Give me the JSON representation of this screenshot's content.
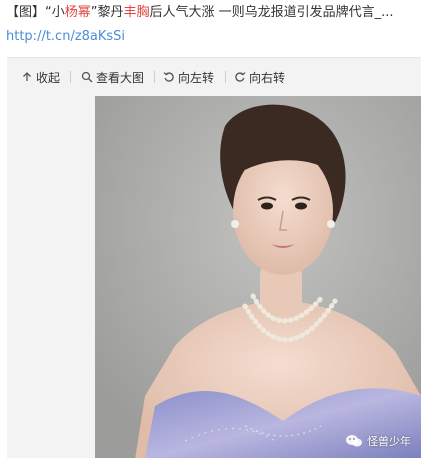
{
  "post": {
    "title_parts": [
      {
        "text": "【图】“小",
        "highlight": false
      },
      {
        "text": "杨幂",
        "highlight": true
      },
      {
        "text": "”黎丹",
        "highlight": false
      },
      {
        "text": "丰胸",
        "highlight": true
      },
      {
        "text": "后人气大涨 一则乌龙报道引发品牌代言_...",
        "highlight": false
      }
    ],
    "link": "http://t.cn/z8aKsSi"
  },
  "toolbar": {
    "collapse_label": "收起",
    "view_large_label": "查看大图",
    "rotate_left_label": "向左转",
    "rotate_right_label": "向右转"
  },
  "watermark": {
    "text": "怪兽少年"
  },
  "colors": {
    "highlight": "#e0463f",
    "link": "#4a8dd6",
    "panel_bg": "#f3f3f3"
  },
  "icons": [
    "collapse-arrow-icon",
    "magnifier-icon",
    "rotate-left-icon",
    "rotate-right-icon",
    "wechat-icon"
  ]
}
